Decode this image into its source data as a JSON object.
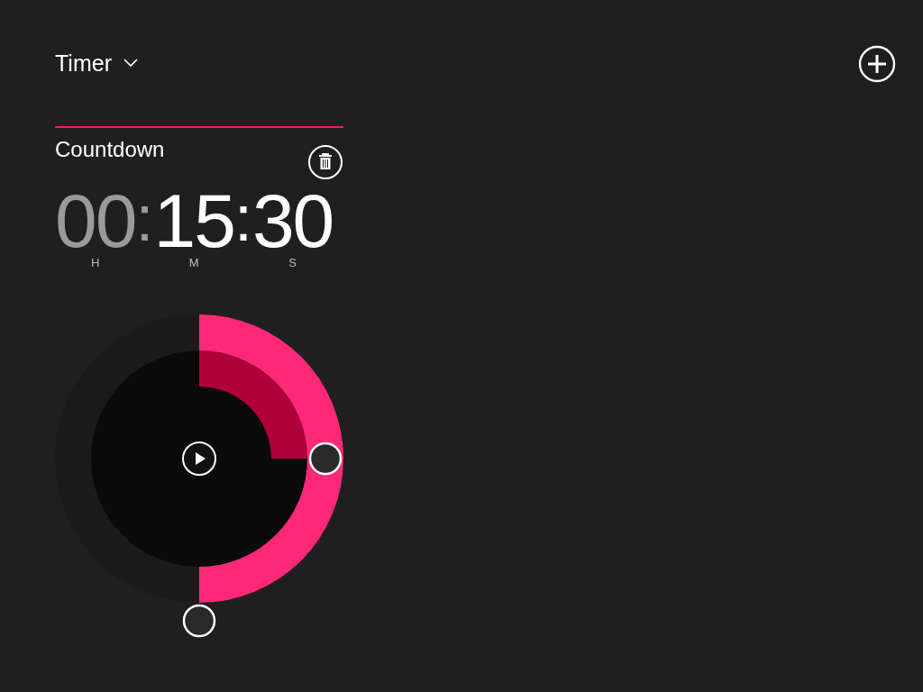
{
  "header": {
    "title": "Timer"
  },
  "timer": {
    "name": "Countdown",
    "time": [
      {
        "value": "00",
        "unit": "H",
        "dimmed": true,
        "separator": ":"
      },
      {
        "value": "15",
        "unit": "M",
        "dimmed": false,
        "separator": ":"
      },
      {
        "value": "30",
        "unit": "S",
        "dimmed": false
      }
    ]
  }
}
